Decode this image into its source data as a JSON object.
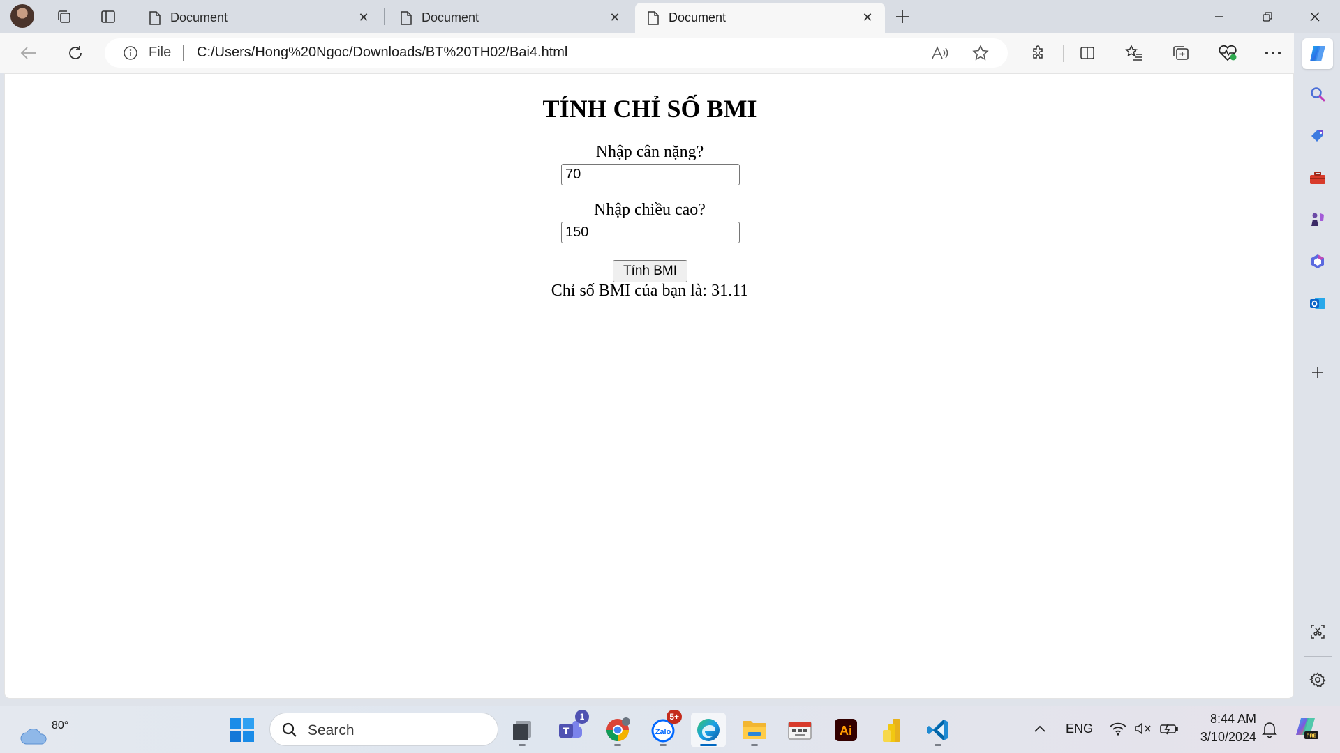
{
  "browser": {
    "tabs": [
      {
        "title": "Document",
        "active": false
      },
      {
        "title": "Document",
        "active": false
      },
      {
        "title": "Document",
        "active": true
      }
    ],
    "address": {
      "scheme_label": "File",
      "url": "C:/Users/Hong%20Ngoc/Downloads/BT%20TH02/Bai4.html"
    }
  },
  "page": {
    "title": "TÍNH CHỈ SỐ BMI",
    "weight_label": "Nhập cân nặng?",
    "weight_value": "70",
    "height_label": "Nhập chiều cao?",
    "height_value": "150",
    "button_label": "Tính BMI",
    "result_text": "Chỉ số BMI của bạn là: 31.11"
  },
  "sidebar": {
    "items": [
      "search-icon",
      "tag-icon",
      "toolbox-icon",
      "games-icon",
      "microsoft365-icon",
      "outlook-icon",
      "add-icon",
      "screenshot-icon",
      "settings-icon"
    ]
  },
  "taskbar": {
    "weather_temp": "80°",
    "search_label": "Search",
    "apps": [
      {
        "name": "file-stack-icon",
        "badge": ""
      },
      {
        "name": "teams-icon",
        "badge": "1"
      },
      {
        "name": "chrome-icon",
        "badge": ""
      },
      {
        "name": "zalo-icon",
        "badge": "5+"
      },
      {
        "name": "edge-icon",
        "badge": ""
      },
      {
        "name": "file-explorer-icon",
        "badge": ""
      },
      {
        "name": "utility-app-icon",
        "badge": ""
      },
      {
        "name": "illustrator-icon",
        "badge": ""
      },
      {
        "name": "power-bi-icon",
        "badge": ""
      },
      {
        "name": "vscode-icon",
        "badge": ""
      }
    ],
    "language": "ENG",
    "time": "8:44 AM",
    "date": "3/10/2024"
  },
  "colors": {
    "accent": "#0067c0",
    "badge_red": "#c42b1c",
    "badge_blue": "#4f52b2",
    "illustrator_bg": "#330000",
    "illustrator_fg": "#ff9a00"
  }
}
